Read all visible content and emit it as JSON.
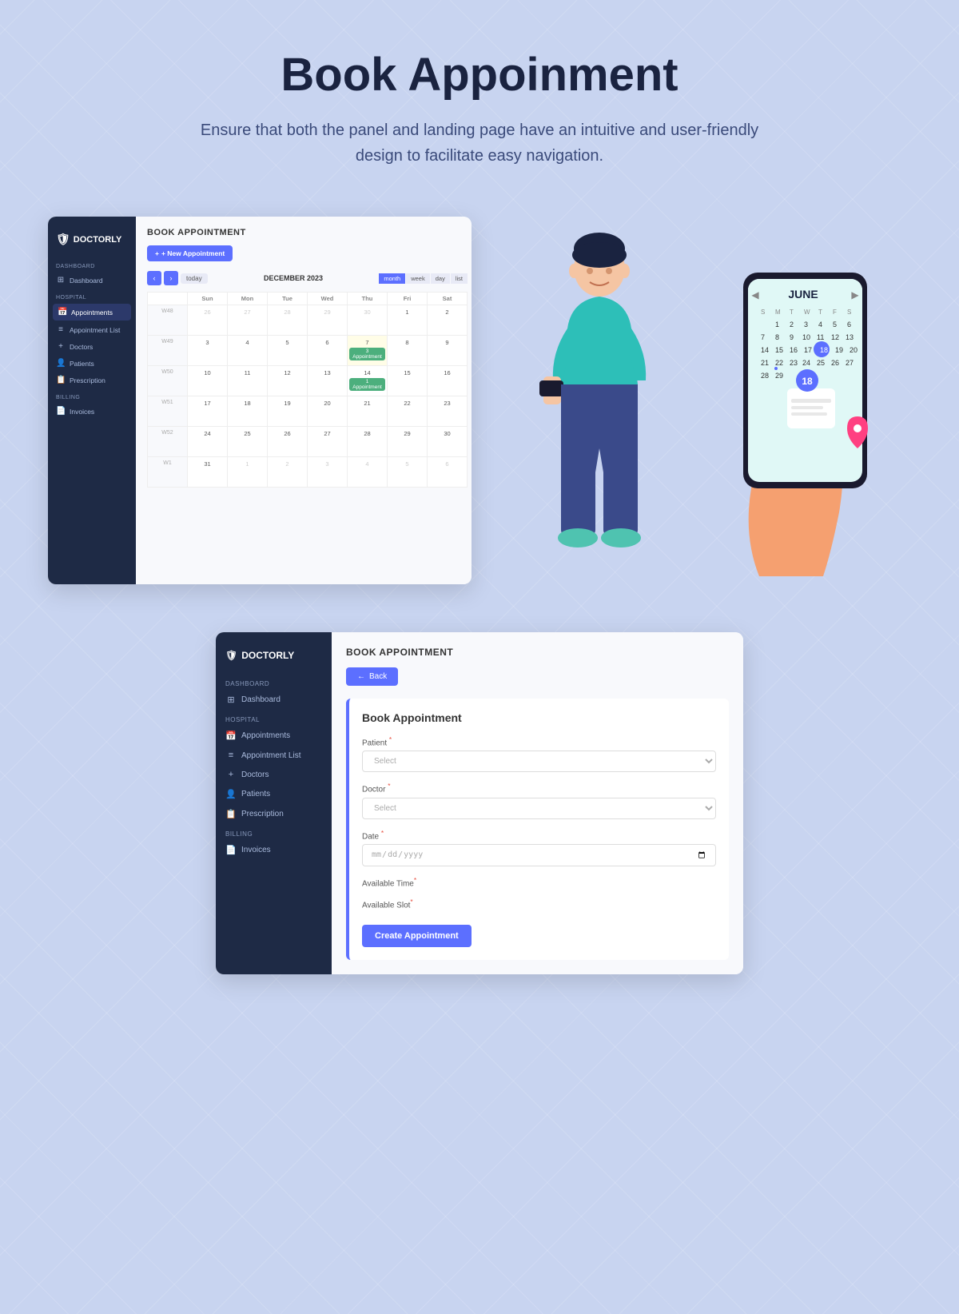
{
  "hero": {
    "title": "Book Appoinment",
    "subtitle": "Ensure that both the panel and landing page have an intuitive and user-friendly design to facilitate easy navigation."
  },
  "topPanel": {
    "sidebar": {
      "logo": "DOCTORLY",
      "sections": [
        {
          "label": "DASHBOARD",
          "items": [
            {
              "icon": "⊞",
              "label": "Dashboard",
              "active": false
            }
          ]
        },
        {
          "label": "HOSPITAL",
          "items": [
            {
              "icon": "📅",
              "label": "Appointments",
              "active": true
            },
            {
              "icon": "≡",
              "label": "Appointment List",
              "active": false
            },
            {
              "icon": "+",
              "label": "Doctors",
              "active": false
            },
            {
              "icon": "👤",
              "label": "Patients",
              "active": false
            },
            {
              "icon": "📋",
              "label": "Prescription",
              "active": false
            }
          ]
        },
        {
          "label": "BILLING",
          "items": [
            {
              "icon": "📄",
              "label": "Invoices",
              "active": false
            }
          ]
        }
      ]
    },
    "main": {
      "title": "BOOK APPOINTMENT",
      "newAppointmentBtn": "+ New Appointment",
      "calendar": {
        "month": "DECEMBER 2023",
        "todayBtn": "today",
        "viewBtns": [
          "month",
          "week",
          "day",
          "list"
        ],
        "activeView": "month",
        "headers": [
          "Sun",
          "Mon",
          "Tue",
          "Wed",
          "Thu",
          "Fri",
          "Sat"
        ],
        "weeks": [
          {
            "label": "W48",
            "days": [
              {
                "day": "26",
                "otherMonth": true
              },
              {
                "day": "27",
                "otherMonth": true
              },
              {
                "day": "28",
                "otherMonth": true
              },
              {
                "day": "29",
                "otherMonth": true
              },
              {
                "day": "30",
                "otherMonth": true
              },
              {
                "day": "1",
                "highlight": false,
                "appointment": ""
              },
              {
                "day": "2",
                "highlight": false
              }
            ]
          },
          {
            "label": "W49",
            "days": [
              {
                "day": "3"
              },
              {
                "day": "4"
              },
              {
                "day": "5"
              },
              {
                "day": "6"
              },
              {
                "day": "7",
                "appointment": "3 Appointment"
              },
              {
                "day": "8"
              },
              {
                "day": "9"
              }
            ]
          },
          {
            "label": "W50",
            "days": [
              {
                "day": "10"
              },
              {
                "day": "11"
              },
              {
                "day": "12"
              },
              {
                "day": "13"
              },
              {
                "day": "14",
                "appointment": "1 Appointment"
              },
              {
                "day": "15"
              },
              {
                "day": "16"
              }
            ]
          },
          {
            "label": "W51",
            "days": [
              {
                "day": "17"
              },
              {
                "day": "18"
              },
              {
                "day": "19"
              },
              {
                "day": "20"
              },
              {
                "day": "21"
              },
              {
                "day": "22"
              },
              {
                "day": "23"
              }
            ]
          },
          {
            "label": "W52",
            "days": [
              {
                "day": "24"
              },
              {
                "day": "25"
              },
              {
                "day": "26"
              },
              {
                "day": "27"
              },
              {
                "day": "28"
              },
              {
                "day": "29"
              },
              {
                "day": "30"
              }
            ]
          },
          {
            "label": "W1",
            "days": [
              {
                "day": "31"
              },
              {
                "day": "1",
                "otherMonth": true
              },
              {
                "day": "2",
                "otherMonth": true
              },
              {
                "day": "3",
                "otherMonth": true
              },
              {
                "day": "4",
                "otherMonth": true
              },
              {
                "day": "5",
                "otherMonth": true
              },
              {
                "day": "6",
                "otherMonth": true
              }
            ]
          }
        ]
      }
    }
  },
  "bottomPanel": {
    "sidebar": {
      "logo": "DOCTORLY",
      "sections": [
        {
          "label": "DASHBOARD",
          "items": [
            {
              "icon": "⊞",
              "label": "Dashboard",
              "active": false
            }
          ]
        },
        {
          "label": "HOSPITAL",
          "items": [
            {
              "icon": "📅",
              "label": "Appointments",
              "active": false
            },
            {
              "icon": "≡",
              "label": "Appointment List",
              "active": false
            },
            {
              "icon": "+",
              "label": "Doctors",
              "active": false
            },
            {
              "icon": "👤",
              "label": "Patients",
              "active": false
            },
            {
              "icon": "📋",
              "label": "Prescription",
              "active": false
            }
          ]
        },
        {
          "label": "BILLING",
          "items": [
            {
              "icon": "📄",
              "label": "Invoices",
              "active": false
            }
          ]
        }
      ]
    },
    "main": {
      "title": "BOOK APPOINTMENT",
      "backBtn": "← Back",
      "formTitle": "Book Appointment",
      "fields": [
        {
          "label": "Patient",
          "required": true,
          "placeholder": "Select",
          "type": "select"
        },
        {
          "label": "Doctor",
          "required": true,
          "placeholder": "Select",
          "type": "select"
        },
        {
          "label": "Date",
          "required": true,
          "placeholder": "",
          "type": "date"
        },
        {
          "label": "Available Time",
          "required": true,
          "placeholder": "",
          "type": "text"
        },
        {
          "label": "Available Slot",
          "required": true,
          "placeholder": "",
          "type": "text"
        }
      ],
      "createBtn": "Create Appointment"
    }
  }
}
